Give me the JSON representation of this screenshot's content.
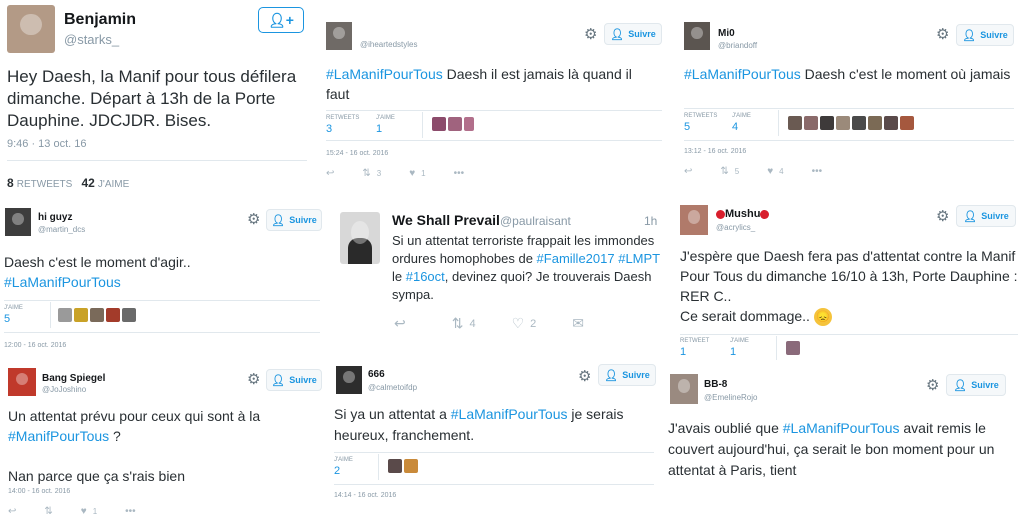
{
  "tweets": [
    {
      "id": "t1",
      "name": "Benjamin",
      "handle": "@starks_",
      "text": "Hey Daesh, la Manif pour tous défilera dimanche. Départ à 13h de la Porte Dauphine. JDCJDR. Bises.",
      "time": "9:46 · 13 oct. 16",
      "retweets_count": "8",
      "retweets_label": "RETWEETS",
      "likes_count": "42",
      "likes_label": "J'AIME"
    },
    {
      "id": "t2",
      "handle": "@iheartedstyles",
      "follow_label": "Suivre",
      "hashtag": "#LaManifPourTous",
      "text": " Daesh il est jamais là quand il faut",
      "retweets_label": "RETWEETS",
      "retweets_count": "3",
      "likes_label": "J'AIME",
      "likes_count": "1",
      "date": "15:24 - 16 oct. 2016",
      "action_retweets": "3",
      "action_likes": "1"
    },
    {
      "id": "t3",
      "name": "Mi0",
      "handle": "@briandoff",
      "follow_label": "Suivre",
      "hashtag": "#LaManifPourTous",
      "text": "  Daesh c'est le moment où jamais",
      "retweets_label": "RETWEETS",
      "retweets_count": "5",
      "likes_label": "J'AIME",
      "likes_count": "4",
      "date": "13:12 - 16 oct. 2016",
      "action_retweets": "5",
      "action_likes": "4"
    },
    {
      "id": "t4",
      "name": "hi guyz",
      "handle": "@martin_dcs",
      "follow_label": "Suivre",
      "text": "Daesh c'est le moment d'agir..",
      "hashtag": "#LaManifPourTous",
      "likes_label": "J'AIME",
      "likes_count": "5",
      "date": "12:00 - 16 oct. 2016"
    },
    {
      "id": "t5",
      "name": "We Shall Prevail",
      "handle": "@paulraisant",
      "time": "1h",
      "text_a": "Si un attentat terroriste frappait les immondes ordures homophobes de ",
      "tag_a": "#Famille2017",
      "tag_b": "#LMPT",
      "text_b": " le ",
      "tag_c": "#16oct",
      "text_c": ", devinez quoi? Je trouverais Daesh sympa.",
      "action_retweets": "4",
      "action_likes": "2"
    },
    {
      "id": "t6",
      "name": "Mushu",
      "handle": "@acrylics_",
      "follow_label": "Suivre",
      "text": "J'espère que Daesh fera pas d'attentat contre la Manif Pour Tous du dimanche 16/10  à 13h, Porte Dauphine : RER C..\nCe serait dommage..",
      "emoji": "😞",
      "retweets_label": "RETWEET",
      "retweets_count": "1",
      "likes_label": "J'AIME",
      "likes_count": "1"
    },
    {
      "id": "t7",
      "name": "Bang Spiegel",
      "handle": "@JoJoshino",
      "follow_label": "Suivre",
      "text_a": "Un attentat prévu pour ceux qui sont à la ",
      "hashtag": "#ManifPourTous",
      "text_b": " ?\n\nNan parce que ça s'rais bien",
      "date": "14:00 - 16 oct. 2016",
      "action_likes": "1"
    },
    {
      "id": "t8",
      "name": "666",
      "handle": "@calmetoifdp",
      "follow_label": "Suivre",
      "text_a": "Si ya un attentat a  ",
      "hashtag": "#LaManifPourTous",
      "text_b": " je serais heureux, franchement.",
      "likes_label": "J'AIME",
      "likes_count": "2",
      "date": "14:14 - 16 oct. 2016"
    },
    {
      "id": "t9",
      "name": "BB-8",
      "handle": "@EmelineRojo",
      "follow_label": "Suivre",
      "text_a": "J'avais oublié que ",
      "hashtag": "#LaManifPourTous",
      "text_b": " avait remis le couvert aujourd'hui, ça serait le bon moment pour un attentat à Paris, tient"
    }
  ],
  "icons": {
    "gear": "gear-icon",
    "follow": "add-user-icon",
    "reply": "reply-icon",
    "retweet": "retweet-icon",
    "like": "heart-icon",
    "more": "more-icon",
    "dm": "message-icon"
  },
  "colors": {
    "accent": "#1b95e0",
    "muted": "#8899a6",
    "text": "#292f33",
    "border": "#e1e8ed"
  }
}
